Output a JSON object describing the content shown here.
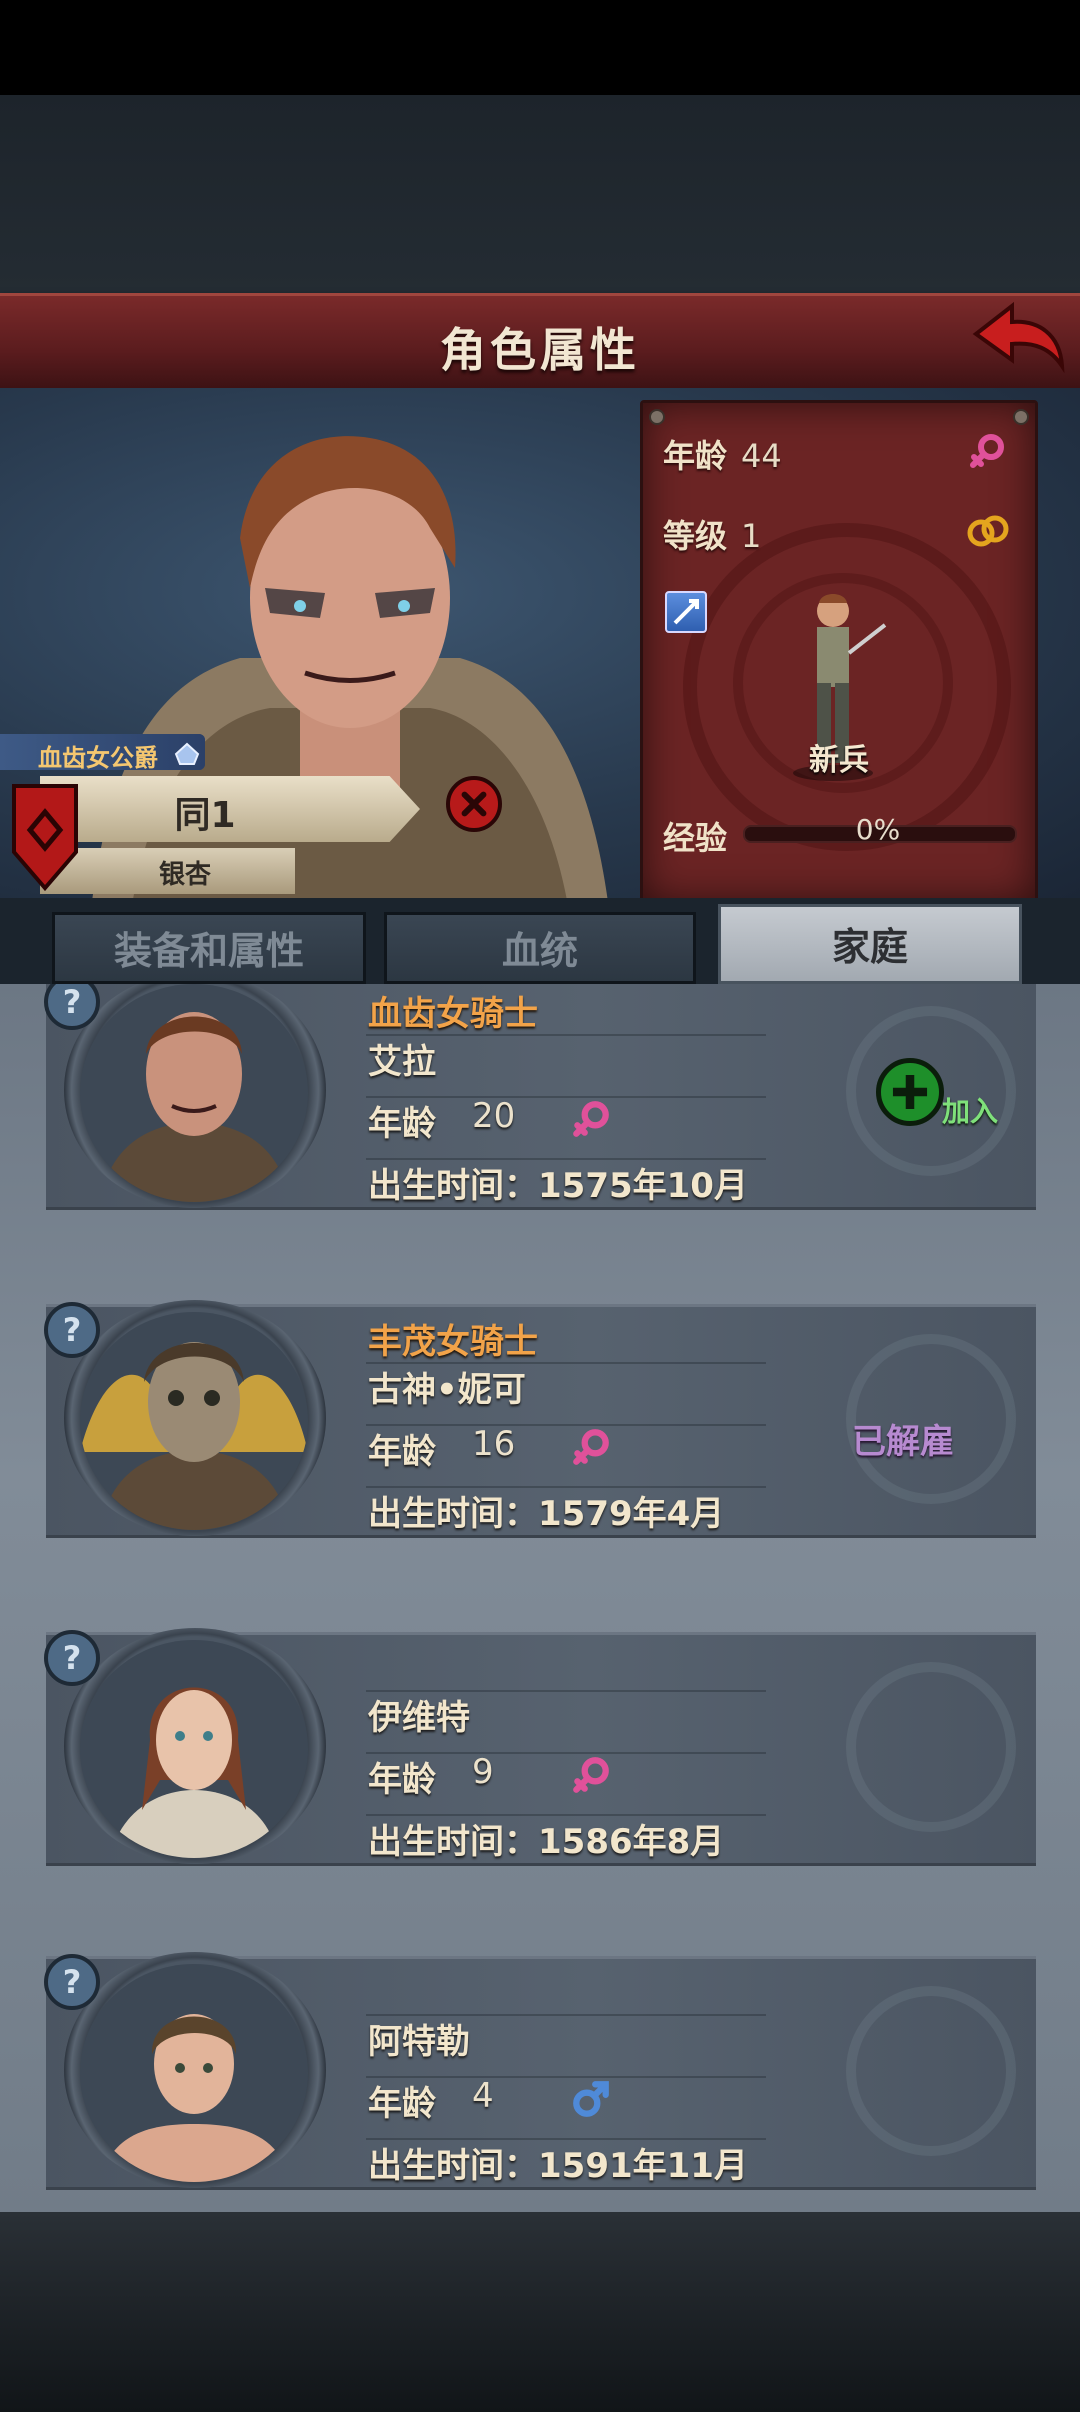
{
  "header": {
    "title": "角色属性",
    "back_icon": "back-arrow-icon"
  },
  "character": {
    "noble_title": "血齿女公爵",
    "name": "同1",
    "house": "银杏",
    "stats": {
      "age_label": "年龄",
      "age": "44",
      "level_label": "等级",
      "level": "1",
      "class": "新兵",
      "exp_label": "经验",
      "exp": "0%",
      "exp_progress": 0
    }
  },
  "tabs": [
    {
      "label": "装备和属性",
      "active": false
    },
    {
      "label": "血统",
      "active": false
    },
    {
      "label": "家庭",
      "active": true
    }
  ],
  "family": [
    {
      "title": "血齿女骑士",
      "name": "艾拉",
      "age_label": "年龄",
      "age": "20",
      "gender": "female",
      "birth": "出生时间：1575年10月",
      "action": "加入"
    },
    {
      "title": "丰茂女骑士",
      "name": "古神•妮可",
      "age_label": "年龄",
      "age": "16",
      "gender": "female",
      "birth": "出生时间：1579年4月",
      "status": "已解雇"
    },
    {
      "title": "",
      "name": "伊维特",
      "age_label": "年龄",
      "age": "9",
      "gender": "female",
      "birth": "出生时间：1586年8月"
    },
    {
      "title": "",
      "name": "阿特勒",
      "age_label": "年龄",
      "age": "4",
      "gender": "male",
      "birth": "出生时间：1591年11月"
    }
  ],
  "colors": {
    "header": "#5b1c1e",
    "title_orange": "#f2a349",
    "female": "#e0519a",
    "male": "#4f8ad8",
    "join": "#1e8f2a"
  }
}
